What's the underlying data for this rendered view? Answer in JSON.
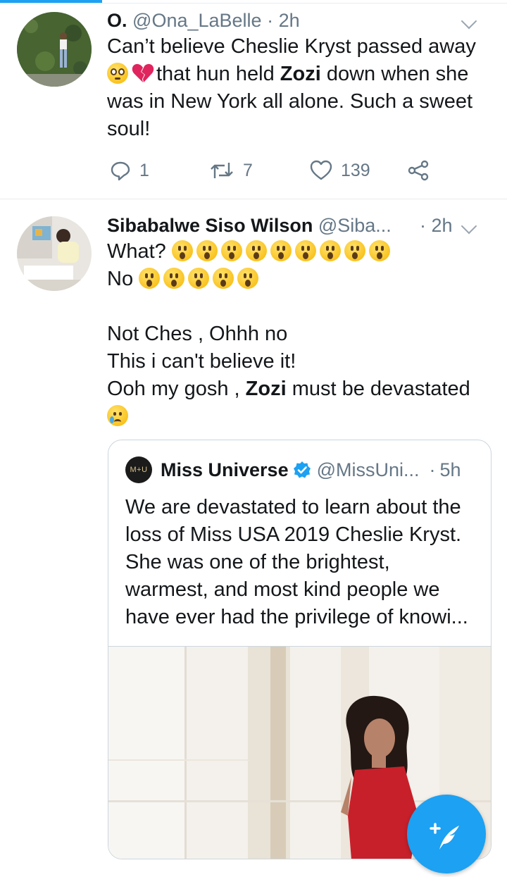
{
  "tweets": [
    {
      "name": "O.",
      "handle": "@Ona_LaBelle",
      "dot": "·",
      "time": "2h",
      "text_line1": "Can’t believe Cheslie Kryst passed away",
      "text_line2_after_emoji": "that hun held ",
      "text_bold": "Zozi",
      "text_line2_end": " down when she",
      "text_line3": "was in New York all alone. Such a sweet",
      "text_line4": "soul!",
      "emojis": [
        "pleading-face",
        "broken-heart"
      ],
      "actions": {
        "reply_count": "1",
        "retweet_count": "7",
        "like_count": "139"
      }
    },
    {
      "name": "Sibabalwe Siso Wilson",
      "handle": "@Siba...",
      "dot": "·",
      "time": "2h",
      "line1": "What?",
      "line1_emoji_count": 9,
      "line2": "No",
      "line2_emoji_count": 5,
      "line3": "Not Ches , Ohhh no",
      "line4": "This i can't believe it!",
      "line5_start": "Ooh my gosh , ",
      "line5_bold": "Zozi",
      "line5_end": " must be devastated",
      "line6_emoji": "crying-face",
      "quoted": {
        "avatar_text": "M+U",
        "name": "Miss Universe",
        "handle": "@MissUni...",
        "dot": "·",
        "time": "5h",
        "line1": "We are devastated to learn about the",
        "line2": "loss of Miss USA 2019 Cheslie Kryst.",
        "line3": "She was one of the brightest,",
        "line4": "warmest, and most kind people we",
        "line5": "have ever had the privilege of knowi..."
      }
    }
  ],
  "colors": {
    "accent": "#1da1f2",
    "secondary_text": "#657786",
    "divider": "#e6ecf0",
    "broken_heart": "#e0245e"
  },
  "fab": {
    "icon": "compose-tweet-icon"
  }
}
